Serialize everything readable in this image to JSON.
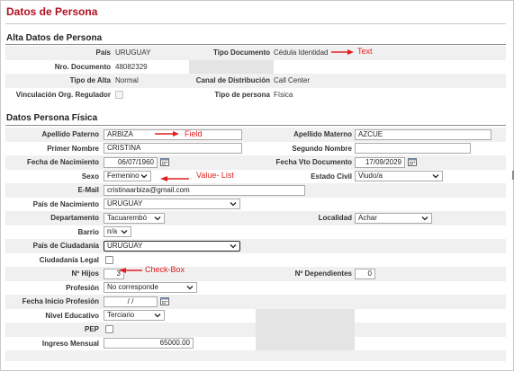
{
  "page": {
    "title": "Datos de Persona"
  },
  "alta": {
    "title": "Alta Datos de Persona",
    "pais_label": "País",
    "pais_value": "URUGUAY",
    "tipo_doc_label": "Tipo Documento",
    "tipo_doc_value": "Cédula Identidad",
    "nro_doc_label": "Nro. Documento",
    "nro_doc_value": "48082329",
    "tipo_alta_label": "Tipo de Alta",
    "tipo_alta_value": "Normal",
    "canal_label": "Canal de Distribución",
    "canal_value": "Call Center",
    "vinc_label": "Vinculación Org. Regulador",
    "vinc_checked": false,
    "tipo_persona_label": "Tipo de persona",
    "tipo_persona_value": "Física"
  },
  "fisica": {
    "title": "Datos Persona Física",
    "apellido_paterno_label": "Apellido Paterno",
    "apellido_paterno_value": "ARBIZA",
    "apellido_materno_label": "Apellido Materno",
    "apellido_materno_value": "AZCUE",
    "primer_nombre_label": "Primer Nombre",
    "primer_nombre_value": "CRISTINA",
    "segundo_nombre_label": "Segundo Nombre",
    "segundo_nombre_value": "",
    "fecha_nac_label": "Fecha de Nacimiento",
    "fecha_nac_value": "06/07/1960",
    "fecha_vto_label": "Fecha Vto Documento",
    "fecha_vto_value": "17/09/2029",
    "sexo_label": "Sexo",
    "sexo_value": "Femenino",
    "estado_civil_label": "Estado Civil",
    "estado_civil_value": "Viudo/a",
    "email_label": "E-Mail",
    "email_value": "cristinaarbiza@gmail.com",
    "pais_nac_label": "País de Nacimiento",
    "pais_nac_value": "URUGUAY",
    "departamento_label": "Departamento",
    "departamento_value": "Tacuarembó",
    "localidad_label": "Localidad",
    "localidad_value": "Achar",
    "barrio_label": "Barrio",
    "barrio_value": "n/a",
    "pais_ciud_label": "País de Ciudadanía",
    "pais_ciud_value": "URUGUAY",
    "ciud_legal_label": "Ciudadanía Legal",
    "ciud_legal_checked": false,
    "hijos_label": "Nº Hijos",
    "hijos_value": "3",
    "dependientes_label": "Nº Dependientes",
    "dependientes_value": "0",
    "profesion_label": "Profesión",
    "profesion_value": "No corresponde",
    "fecha_prof_label": "Fecha Inicio Profesión",
    "fecha_prof_value": "/ /",
    "nivel_edu_label": "Nivel Educativo",
    "nivel_edu_value": "Terciario",
    "pep_label": "PEP",
    "pep_checked": false,
    "ingreso_label": "Ingreso Mensual",
    "ingreso_value": "65000.00"
  },
  "annotations": {
    "text": "Text",
    "field": "Field",
    "value_list": "Value- List",
    "check_box": "Check-Box"
  },
  "colors": {
    "title": "#b01020",
    "annotation": "#e02020",
    "row_alt": "#f0f0f0",
    "gray_block": "#e4e4e4"
  }
}
